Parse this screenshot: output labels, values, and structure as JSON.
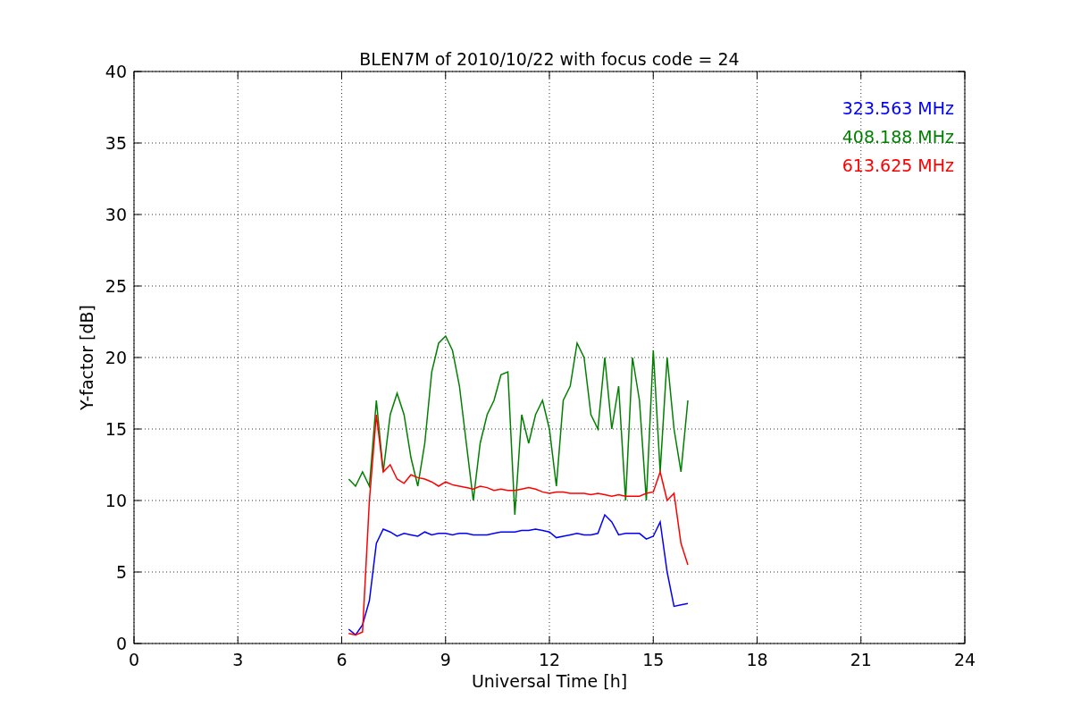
{
  "figure": {
    "chart_data": {
      "type": "line",
      "grid": true,
      "title": "BLEN7M of 2010/10/22 with focus code = 24",
      "xlabel": "Universal Time [h]",
      "ylabel": "Y-factor [dB]",
      "xlim": [
        0,
        24
      ],
      "ylim": [
        0,
        40
      ],
      "xticks": [
        0,
        3,
        6,
        9,
        12,
        15,
        18,
        21,
        24
      ],
      "yticks": [
        0,
        5,
        10,
        15,
        20,
        25,
        30,
        35,
        40
      ],
      "x": [
        6.2,
        6.4,
        6.6,
        6.8,
        7.0,
        7.2,
        7.4,
        7.6,
        7.8,
        8.0,
        8.2,
        8.4,
        8.6,
        8.8,
        9.0,
        9.2,
        9.4,
        9.6,
        9.8,
        10.0,
        10.2,
        10.4,
        10.6,
        10.8,
        11.0,
        11.2,
        11.4,
        11.6,
        11.8,
        12.0,
        12.2,
        12.4,
        12.6,
        12.8,
        13.0,
        13.2,
        13.4,
        13.6,
        13.8,
        14.0,
        14.2,
        14.4,
        14.6,
        14.8,
        15.0,
        15.2,
        15.4,
        15.6,
        15.8,
        16.0
      ],
      "series": [
        {
          "name": "323.563 MHz",
          "color": "#0000ff",
          "values": [
            1.0,
            0.6,
            1.3,
            3,
            7,
            8,
            7.8,
            7.5,
            7.7,
            7.6,
            7.5,
            7.8,
            7.6,
            7.7,
            7.7,
            7.6,
            7.7,
            7.7,
            7.6,
            7.6,
            7.6,
            7.7,
            7.8,
            7.8,
            7.8,
            7.9,
            7.9,
            8.0,
            7.9,
            7.8,
            7.4,
            7.5,
            7.6,
            7.7,
            7.6,
            7.6,
            7.7,
            9,
            8.5,
            7.6,
            7.7,
            7.7,
            7.7,
            7.3,
            7.5,
            8.5,
            5,
            2.6,
            2.7,
            2.8
          ]
        },
        {
          "name": "408.188 MHz",
          "color": "#008000",
          "values": [
            11.5,
            11,
            12,
            11,
            17,
            12,
            16,
            17.5,
            16,
            13,
            11,
            14,
            19,
            21,
            21.5,
            20.5,
            18,
            14,
            10,
            14,
            16,
            17,
            18.8,
            19,
            9,
            16,
            14,
            16,
            17,
            15,
            11,
            17,
            18,
            21,
            20,
            16,
            15,
            20,
            15,
            18,
            10,
            20,
            17,
            10,
            20.5,
            12,
            20,
            15,
            12,
            17
          ]
        },
        {
          "name": "613.625 MHz",
          "color": "#ff0000",
          "values": [
            0.7,
            0.6,
            0.8,
            10,
            16,
            12,
            12.5,
            11.5,
            11.2,
            11.8,
            11.6,
            11.5,
            11.3,
            11,
            11.3,
            11.1,
            11,
            10.9,
            10.8,
            11,
            10.9,
            10.7,
            10.8,
            10.7,
            10.7,
            10.8,
            10.9,
            10.8,
            10.6,
            10.5,
            10.6,
            10.6,
            10.5,
            10.5,
            10.5,
            10.4,
            10.5,
            10.4,
            10.3,
            10.4,
            10.3,
            10.3,
            10.3,
            10.5,
            10.6,
            12,
            10,
            10.5,
            7,
            5.5
          ]
        }
      ]
    }
  }
}
